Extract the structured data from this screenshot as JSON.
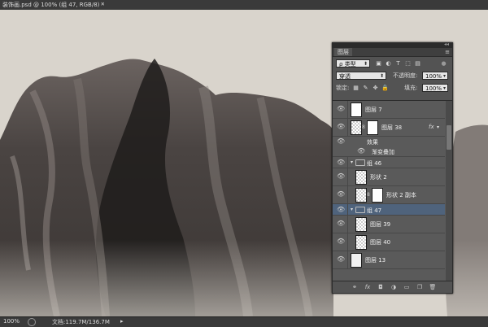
{
  "document": {
    "tab_title": "装饰画.psd @ 100% (组 47, RGB/8) *",
    "close": "×"
  },
  "layers_panel": {
    "tab_label": "图层",
    "collapse": "◂◂",
    "menu_icon": "≡",
    "filter_type": "类型",
    "filter_search": "ρ",
    "blend_mode": "穿透",
    "opacity_label": "不透明度:",
    "opacity_value": "100%",
    "lock_label": "锁定:",
    "fill_label": "填充:",
    "fill_value": "100%",
    "layers": [
      {
        "name": "图层 7"
      },
      {
        "name": "图层 38",
        "fx": "fx"
      },
      {
        "name": "效果"
      },
      {
        "name": "渐变叠加"
      },
      {
        "name": "组 46"
      },
      {
        "name": "形状 2"
      },
      {
        "name": "形状 2 副本"
      },
      {
        "name": "组 47"
      },
      {
        "name": "图层 39"
      },
      {
        "name": "图层 40"
      },
      {
        "name": "图层 13"
      }
    ],
    "selected_layer": "组 47"
  },
  "status_bar": {
    "zoom": "100%",
    "doc_info": "文档:119.7M/136.7M",
    "arrow": "▸"
  },
  "colors": {
    "canvas_background": "#d9d4cc",
    "rock_dark": "#2a2624",
    "panel_bg": "#535353",
    "selected_row": "#4f637c"
  },
  "icons": [
    "eye-icon",
    "chain-link-icon",
    "folder-icon",
    "lock-icon",
    "search-icon",
    "filter-icons",
    "fx-icon",
    "new-layer-icon",
    "trash-icon",
    "mask-icon",
    "adjustment-icon",
    "group-icon"
  ]
}
